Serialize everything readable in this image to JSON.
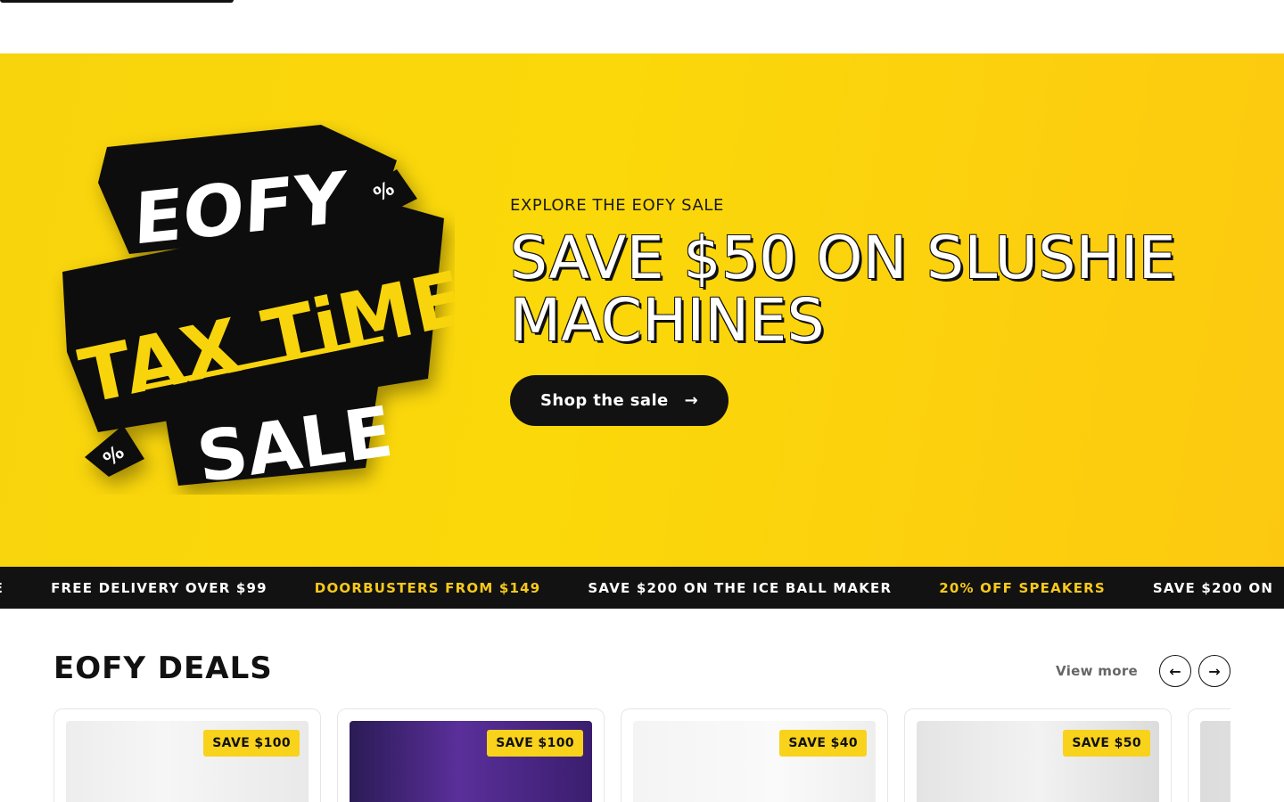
{
  "hero": {
    "logo": {
      "line1": "EOFY",
      "line2": "TAX TiME",
      "line3": "SALE",
      "tag": "%"
    },
    "eyebrow": "EXPLORE THE EOFY SALE",
    "title": "SAVE $50 ON SLUSHIE MACHINES",
    "cta_label": "Shop the sale",
    "cta_icon": "→",
    "colors": {
      "background": "#f8d40c",
      "cta": "#121212"
    }
  },
  "marquee": {
    "items": [
      {
        "text": "EWIDE",
        "accent": false
      },
      {
        "text": "FREE DELIVERY OVER $99",
        "accent": false
      },
      {
        "text": "DOORBUSTERS FROM $149",
        "accent": true
      },
      {
        "text": "SAVE $200 ON THE ICE BALL MAKER",
        "accent": false
      },
      {
        "text": "20% OFF SPEAKERS",
        "accent": true
      },
      {
        "text": "SAVE $200 ON",
        "accent": false
      }
    ],
    "colors": {
      "background": "#121212",
      "text": "#ffffff",
      "accent": "#f8c91c"
    }
  },
  "deals": {
    "title": "EOFY DEALS",
    "view_more": "View more",
    "prev_icon": "←",
    "next_icon": "→",
    "cards": [
      {
        "badge": "SAVE $100",
        "image": "mirror-product-image"
      },
      {
        "badge": "SAVE $100",
        "image": "bubble-lamp-product-image"
      },
      {
        "badge": "SAVE $40",
        "image": "hooded-blanket-product-image"
      },
      {
        "badge": "SAVE $50",
        "image": "slushie-machine-product-image"
      },
      {
        "badge": "",
        "image": "product-image"
      }
    ],
    "colors": {
      "badge": "#f8d21b"
    }
  }
}
